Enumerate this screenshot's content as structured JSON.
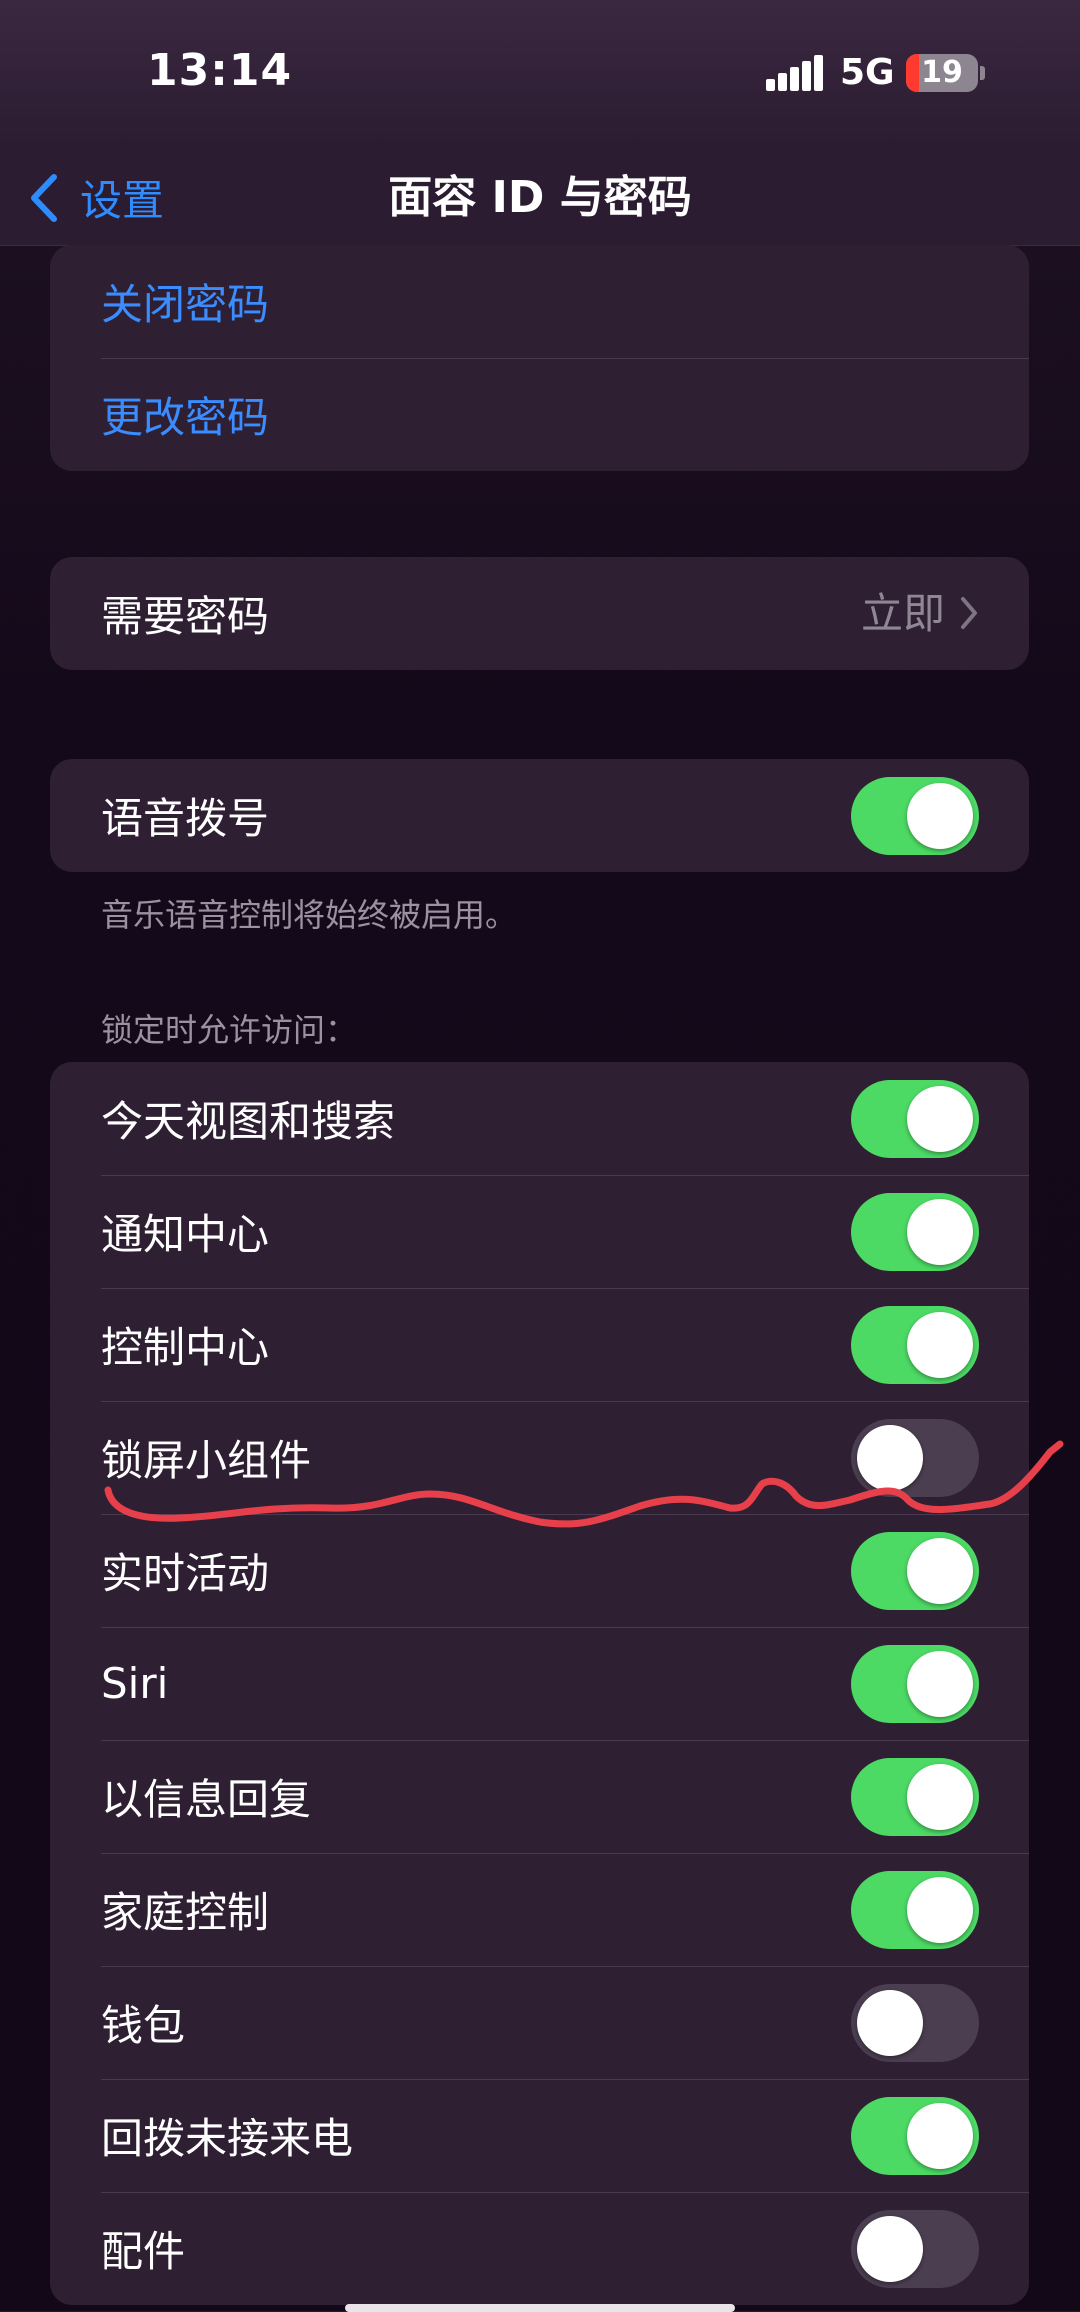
{
  "status_bar": {
    "time": "13:14",
    "network": "5G",
    "battery_level": "19"
  },
  "nav": {
    "back_label": "设置",
    "title": "面容 ID 与密码"
  },
  "passcode_group": {
    "turn_off_label": "关闭密码",
    "change_label": "更改密码"
  },
  "require_passcode": {
    "label": "需要密码",
    "value": "立即"
  },
  "voice_dial": {
    "label": "语音拨号",
    "enabled": true,
    "footer": "音乐语音控制将始终被启用。"
  },
  "lock_access": {
    "header": "锁定时允许访问：",
    "items": [
      {
        "label": "今天视图和搜索",
        "enabled": true
      },
      {
        "label": "通知中心",
        "enabled": true
      },
      {
        "label": "控制中心",
        "enabled": true
      },
      {
        "label": "锁屏小组件",
        "enabled": false
      },
      {
        "label": "实时活动",
        "enabled": true
      },
      {
        "label": "Siri",
        "enabled": true
      },
      {
        "label": "以信息回复",
        "enabled": true
      },
      {
        "label": "家庭控制",
        "enabled": true
      },
      {
        "label": "钱包",
        "enabled": false
      },
      {
        "label": "回拨未接来电",
        "enabled": true
      },
      {
        "label": "配件",
        "enabled": false
      }
    ]
  },
  "colors": {
    "toggle_on": "#4cd964",
    "toggle_off": "#4a3e50",
    "link_blue": "#3a8cff",
    "annotation_red": "#e8404a"
  }
}
